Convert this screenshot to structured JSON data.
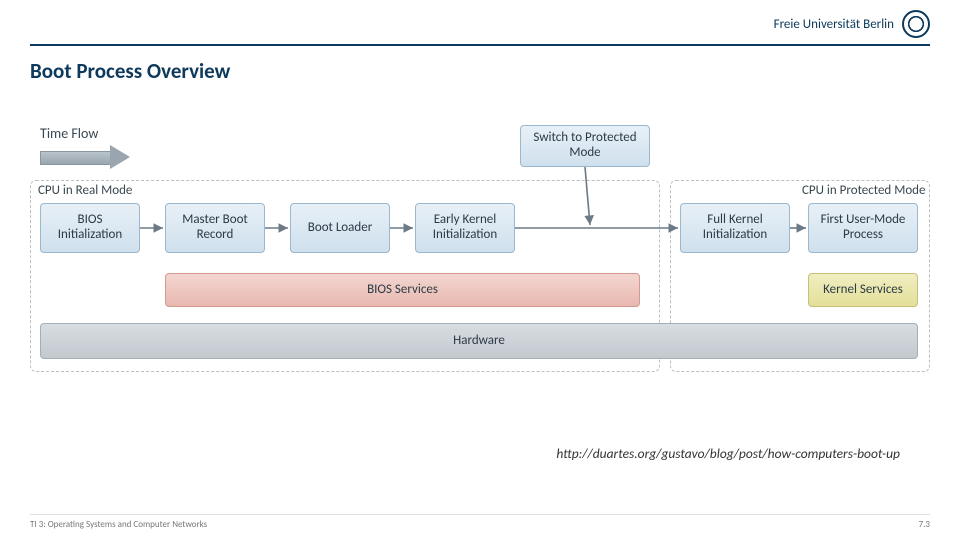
{
  "brand": {
    "name": "Freie Universität Berlin"
  },
  "title": "Boot Process Overview",
  "diagram": {
    "labels": {
      "time_flow": "Time Flow",
      "switch_protected": "Switch to Protected Mode",
      "real_mode_region": "CPU in Real Mode",
      "protected_mode_region": "CPU in Protected Mode"
    },
    "stages": {
      "bios_init": "BIOS Initialization",
      "mbr": "Master Boot Record",
      "boot_loader": "Boot Loader",
      "early_kernel": "Early Kernel Initialization",
      "full_kernel": "Full Kernel Initialization",
      "first_user": "First User-Mode Process"
    },
    "layers": {
      "bios_services": "BIOS Services",
      "hardware": "Hardware",
      "kernel_services": "Kernel Services"
    }
  },
  "source_url": "http://duartes.org/gustavo/blog/post/how-computers-boot-up",
  "footer": {
    "left": "TI 3: Operating Systems and Computer Networks",
    "right": "7.3"
  }
}
